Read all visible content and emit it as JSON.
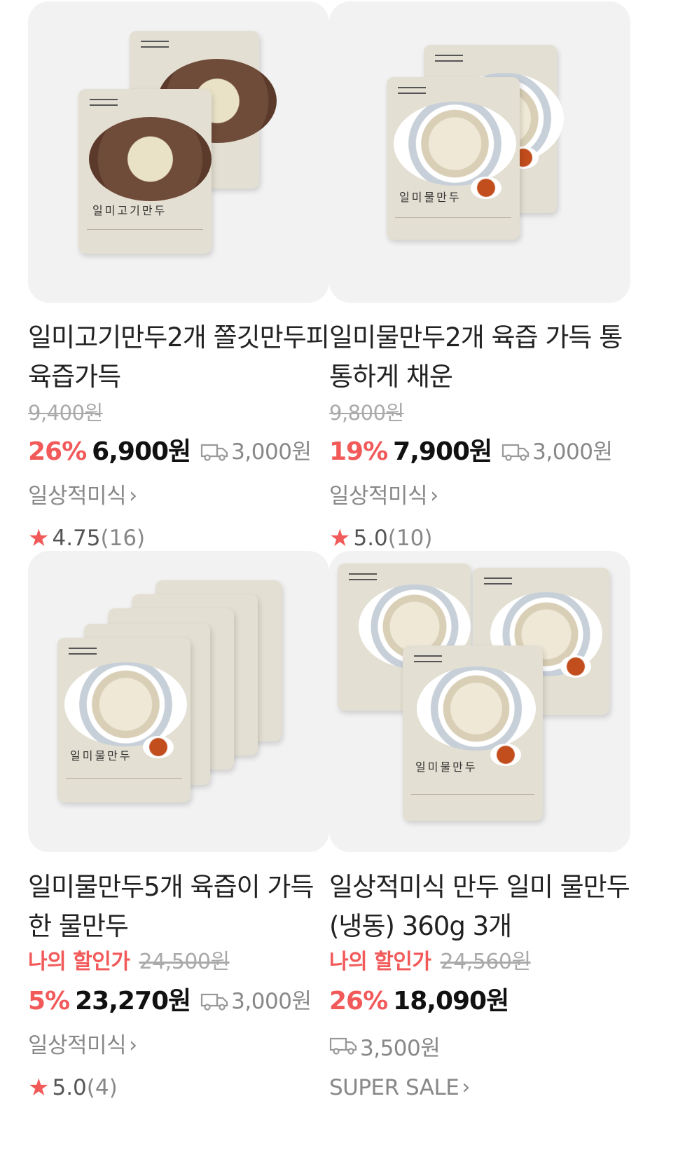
{
  "products": [
    {
      "title": "일미고기만두2개 쫄깃만두피 육즙가득",
      "original_price": "9,400원",
      "my_deal_label": "",
      "discount": "26%",
      "price": "6,900원",
      "shipping": "3,000원",
      "seller": "일상적미식",
      "rating": "4.75",
      "review_count": "(16)",
      "image": {
        "variant": "meat-dumpling-2pack",
        "name_on_pack": "일미고기만두"
      }
    },
    {
      "title": "일미물만두2개 육즙 가득 통통하게 채운",
      "original_price": "9,800원",
      "my_deal_label": "",
      "discount": "19%",
      "price": "7,900원",
      "shipping": "3,000원",
      "seller": "일상적미식",
      "rating": "5.0",
      "review_count": "(10)",
      "image": {
        "variant": "water-dumpling-2pack",
        "name_on_pack": "일미물만두"
      }
    },
    {
      "title": "일미물만두5개 육즙이 가득한 물만두",
      "original_price": "24,500원",
      "my_deal_label": "나의 할인가",
      "discount": "5%",
      "price": "23,270원",
      "shipping": "3,000원",
      "seller": "일상적미식",
      "rating": "5.0",
      "review_count": "(4)",
      "image": {
        "variant": "water-dumpling-5pack",
        "name_on_pack": "일미물만두"
      }
    },
    {
      "title": "일상적미식 만두 일미 물만두 (냉동) 360g 3개",
      "original_price": "24,560원",
      "my_deal_label": "나의 할인가",
      "discount": "26%",
      "price": "18,090원",
      "shipping": "3,500원",
      "seller": "SUPER SALE",
      "rating": "",
      "review_count": "",
      "image": {
        "variant": "water-dumpling-3pack",
        "name_on_pack": "일미물만두"
      }
    }
  ],
  "colors": {
    "accent": "#f25a5a",
    "muted": "#888888",
    "thumb_bg": "#f2f2f2"
  },
  "icons": {
    "shipping": "truck-icon",
    "seller_arrow": "chevron-right-icon",
    "rating": "star-icon"
  },
  "glyphs": {
    "chevron": "›",
    "star": "★"
  }
}
